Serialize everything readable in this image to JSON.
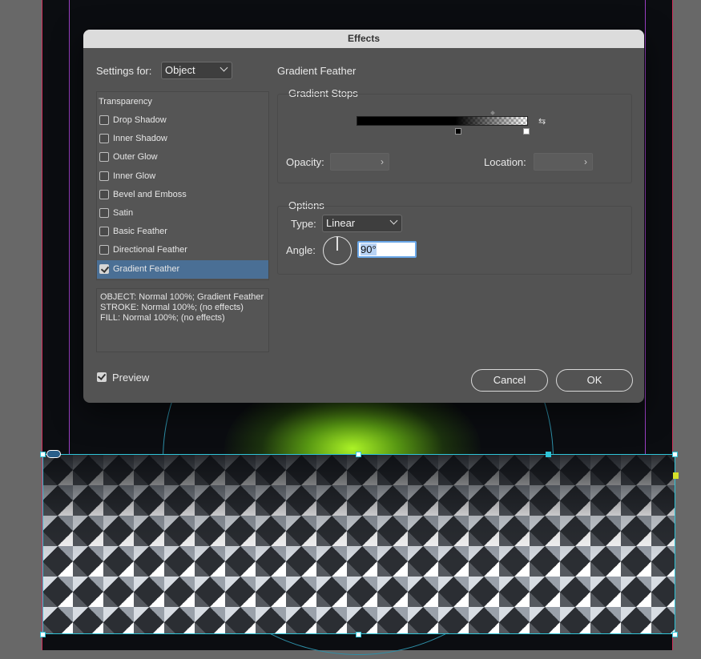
{
  "dialog": {
    "title": "Effects",
    "settings_for_label": "Settings for:",
    "settings_for_value": "Object",
    "panel_title": "Gradient Feather"
  },
  "effects_list": {
    "header": "Transparency",
    "items": [
      {
        "label": "Drop Shadow",
        "checked": false
      },
      {
        "label": "Inner Shadow",
        "checked": false
      },
      {
        "label": "Outer Glow",
        "checked": false
      },
      {
        "label": "Inner Glow",
        "checked": false
      },
      {
        "label": "Bevel and Emboss",
        "checked": false
      },
      {
        "label": "Satin",
        "checked": false
      },
      {
        "label": "Basic Feather",
        "checked": false
      },
      {
        "label": "Directional Feather",
        "checked": false
      },
      {
        "label": "Gradient Feather",
        "checked": true
      }
    ]
  },
  "summary": {
    "line1": "OBJECT: Normal 100%; Gradient Feather",
    "line2": "STROKE: Normal 100%; (no effects)",
    "line3": "FILL: Normal 100%; (no effects)"
  },
  "gradient_stops": {
    "title": "Gradient Stops",
    "opacity_label": "Opacity:",
    "location_label": "Location:"
  },
  "options": {
    "title": "Options",
    "type_label": "Type:",
    "type_value": "Linear",
    "angle_label": "Angle:",
    "angle_value": "90°"
  },
  "footer": {
    "preview_label": "Preview",
    "cancel_label": "Cancel",
    "ok_label": "OK"
  },
  "icons": {
    "chevron": "chevron-down-icon",
    "reverse": "reverse-gradient-icon",
    "arrow": "chevron-right-icon"
  },
  "colors": {
    "dialog_bg": "#535353",
    "selection": "#4a6f95",
    "frame_guide": "#2fc4d8",
    "glow": "#b4ff28"
  }
}
